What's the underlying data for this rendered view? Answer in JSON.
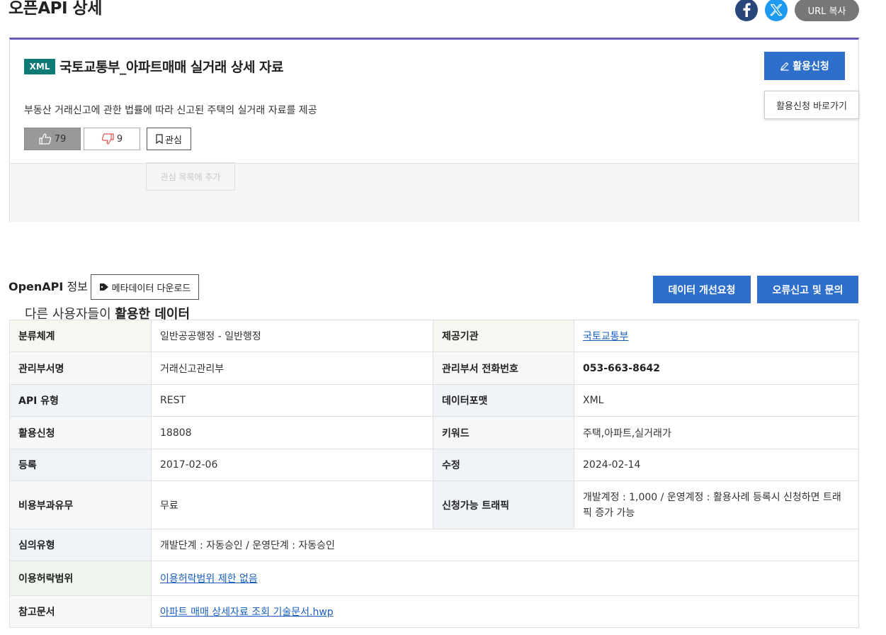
{
  "page": {
    "title": "오픈API 상세",
    "url_copy_label": "URL 복사"
  },
  "colors": {
    "accent": "#6c58b8",
    "primary_button": "#2e6fcb",
    "format_badge": "#0e7a75",
    "facebook": "#29467a",
    "twitter": "#1d9bf0"
  },
  "dataset": {
    "format_badge": "XML",
    "title": "국토교통부_아파트매매 실거래 상세 자료",
    "apply_label": "활용신청",
    "tooltip": "활용신청 바로가기",
    "description": "부동산 거래신고에 관한 법률에 따라 신고된 주택의 실거래 자료를 제공",
    "likes": "79",
    "dislikes": "9",
    "favorite_label": "관심",
    "favorite_ghost": "관심 목록에 추가",
    "other_users_prefix": "다른 사용자들이 ",
    "other_users_strong": "활용한 데이터"
  },
  "openapi": {
    "title_bold": "OpenAPI",
    "title_rest": " 정보",
    "metadata_download": "메타데이터 다운로드",
    "improve_request": "데이터 개선요청",
    "error_report": "오류신고 및 문의"
  },
  "info": {
    "category_label": "분류체계",
    "category_value": "일반공공행정 - 일반행정",
    "provider_label": "제공기관",
    "provider_value": "국토교통부",
    "dept_label": "관리부서명",
    "dept_value": "거래신고관리부",
    "phone_label": "관리부서 전화번호",
    "phone_value": "053-663-8642",
    "api_type_label": "API 유형",
    "api_type_value": "REST",
    "format_label": "데이터포맷",
    "format_value": "XML",
    "apply_count_label": "활용신청",
    "apply_count_value": "18808",
    "keyword_label": "키워드",
    "keyword_value": "주택,아파트,실거래가",
    "registered_label": "등록",
    "registered_value": "2017-02-06",
    "modified_label": "수정",
    "modified_value": "2024-02-14",
    "fee_label": "비용부과유무",
    "fee_value": "무료",
    "traffic_label": "신청가능 트래픽",
    "traffic_value": "개발계정 : 1,000 / 운영계정 : 활용사례 등록시 신청하면 트래픽 증가 가능",
    "review_label": "심의유형",
    "review_value": "개발단계 : 자동승인 / 운영단계 : 자동승인",
    "license_label": "이용허락범위",
    "license_value": "이용허락범위 제한 없음",
    "refdoc_label": "참고문서",
    "refdoc_value": "아파트 매매 상세자료 조회 기술문서.hwp"
  }
}
